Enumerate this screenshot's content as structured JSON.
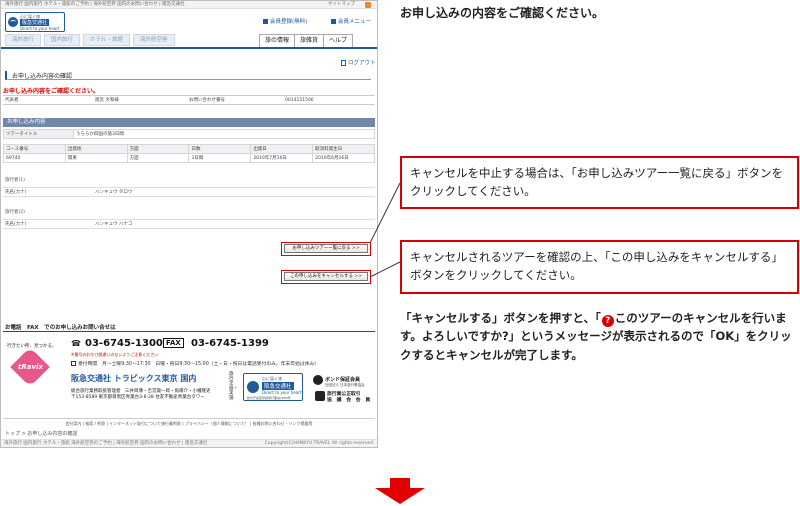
{
  "shot": {
    "top_notice": "海外旅行 国内旅行 ホテル・旅館のご予約 | 海外航空券 国内のお問い合わせ | 阪急交通社",
    "top_links": "サイトマップ",
    "brand": {
      "small": "心に届く旅",
      "name": "阪急交通社",
      "tagline": "Direct to your heart"
    },
    "register_link": "会員登録(無料)",
    "member_menu": "会員メニュー",
    "tabs": [
      "海外旅行",
      "国内旅行",
      "ホテル・旅館",
      "海外航空券"
    ],
    "right_nav": [
      "旅の情報",
      "旅雑貨",
      "ヘルプ"
    ],
    "logout": "ログアウト",
    "section_title": "お申し込み内容の確認",
    "red_note": "お申し込み内容をご確認ください。",
    "rep": {
      "label": "代表者",
      "name": "阪急 大和様",
      "inq_label": "お問い合わせ番号",
      "inq_no": "0014151506"
    },
    "bar_title": "お申し込み内容",
    "tour": {
      "label": "ツアータイトル",
      "value": "うららか四国の旅3日間"
    },
    "table_headers": [
      "コース番号",
      "出発地",
      "方面",
      "日数",
      "出発日",
      "取消料発生日"
    ],
    "table_values": [
      "69740",
      "関東",
      "方面",
      "3日間",
      "2010年7月16日",
      "2010年6月26日"
    ],
    "traveler1": {
      "section": "旅行者(1)",
      "label": "氏名(カナ)",
      "value": "ハンキュウ タロウ"
    },
    "traveler2": {
      "section": "旅行者(2)",
      "label": "氏名(カナ)",
      "value": "ハンキュウ ハナコ"
    },
    "btn_back": "お申し込みツアー一覧に戻る",
    "btn_cancel": "この申し込みをキャンセルする",
    "contact_title": "お電話　FAX　でのお申し込みお問い合せは",
    "catchphrase": "行きたい所、見つかる。",
    "phone": "03-6745-1300",
    "fax_tag": "FAX",
    "fax": "03-6745-1399",
    "phone_note": "※番号のおかけ間違いのないようご注意ください",
    "hours_label": "受付時間",
    "hours": "月～土曜9:30～17:30　日曜・祝日9:30～15:00（土・日・祝日は電話受付のみ。年末年始は休み）",
    "office": "阪急交通社 トラビックス東京 国内",
    "addr1": "総合旅行業務取扱管理者　三井目簿・吉宮瀧一郎・角陽介・小幡隆史",
    "addr2": "〒153-8589 東京都目黒区青葉台3-6-28 住友不動産青葉台タワー",
    "vert_label": "旅行企画・実施",
    "brand2": {
      "small": "心に届く旅",
      "name": "阪急交通社",
      "tagline": "Direct to your heart",
      "note": "観光庁長官登録旅行業第1889号"
    },
    "bond": {
      "name": "ボンド保証会員",
      "sub": "社団法人 日本旅行業協会"
    },
    "jata": {
      "line1": "旅行業公正取引",
      "line2": "協　議　会　会　員"
    },
    "heart_logo": "tRavix",
    "footer_links": "会社案内 | 検索 / 約款 | インターネット取引について旅行業約款 | プライバシー（個人情報について） | 各種お問い合わせ・リンク掲載等",
    "breadcrumb_link": "トップ",
    "breadcrumb_current": "お申し込み内容の確認",
    "bottom_left": "海外旅行 国内旅行 ホテル・旅館 海外航空券のご予約 | 海外航空券 国内のお問い合わせ | 阪急交通社",
    "copyright": "Copyright(C)HANKYU TRAVEL All rights reserved"
  },
  "instructions": {
    "heading": "お申し込みの内容をご確認ください。",
    "callout1": "キャンセルを中止する場合は、「お申し込みツアー一覧に戻る」ボタンをクリックしてください。",
    "callout2": "キャンセルされるツアーを確認の上、「この申し込みをキャンセルする」ボタンをクリックしてください。",
    "para_a": "「キャンセルする」ボタンを押すと、「",
    "para_q": "?",
    "para_b": "このツアーのキャンセルを行います。よろしいですか?」というメッセージが表示されるので「OK」をクリックするとキャンセルが完了します。"
  },
  "colors": {
    "brand_blue": "#1e5aa0",
    "accent_red": "#d40000",
    "bar": "#6f87a9",
    "heart": "#e8578a"
  },
  "icons": [
    "rss-icon",
    "brand-bird-icon",
    "logout-icon",
    "phone-icon",
    "down-arrow-icon",
    "question-icon"
  ]
}
